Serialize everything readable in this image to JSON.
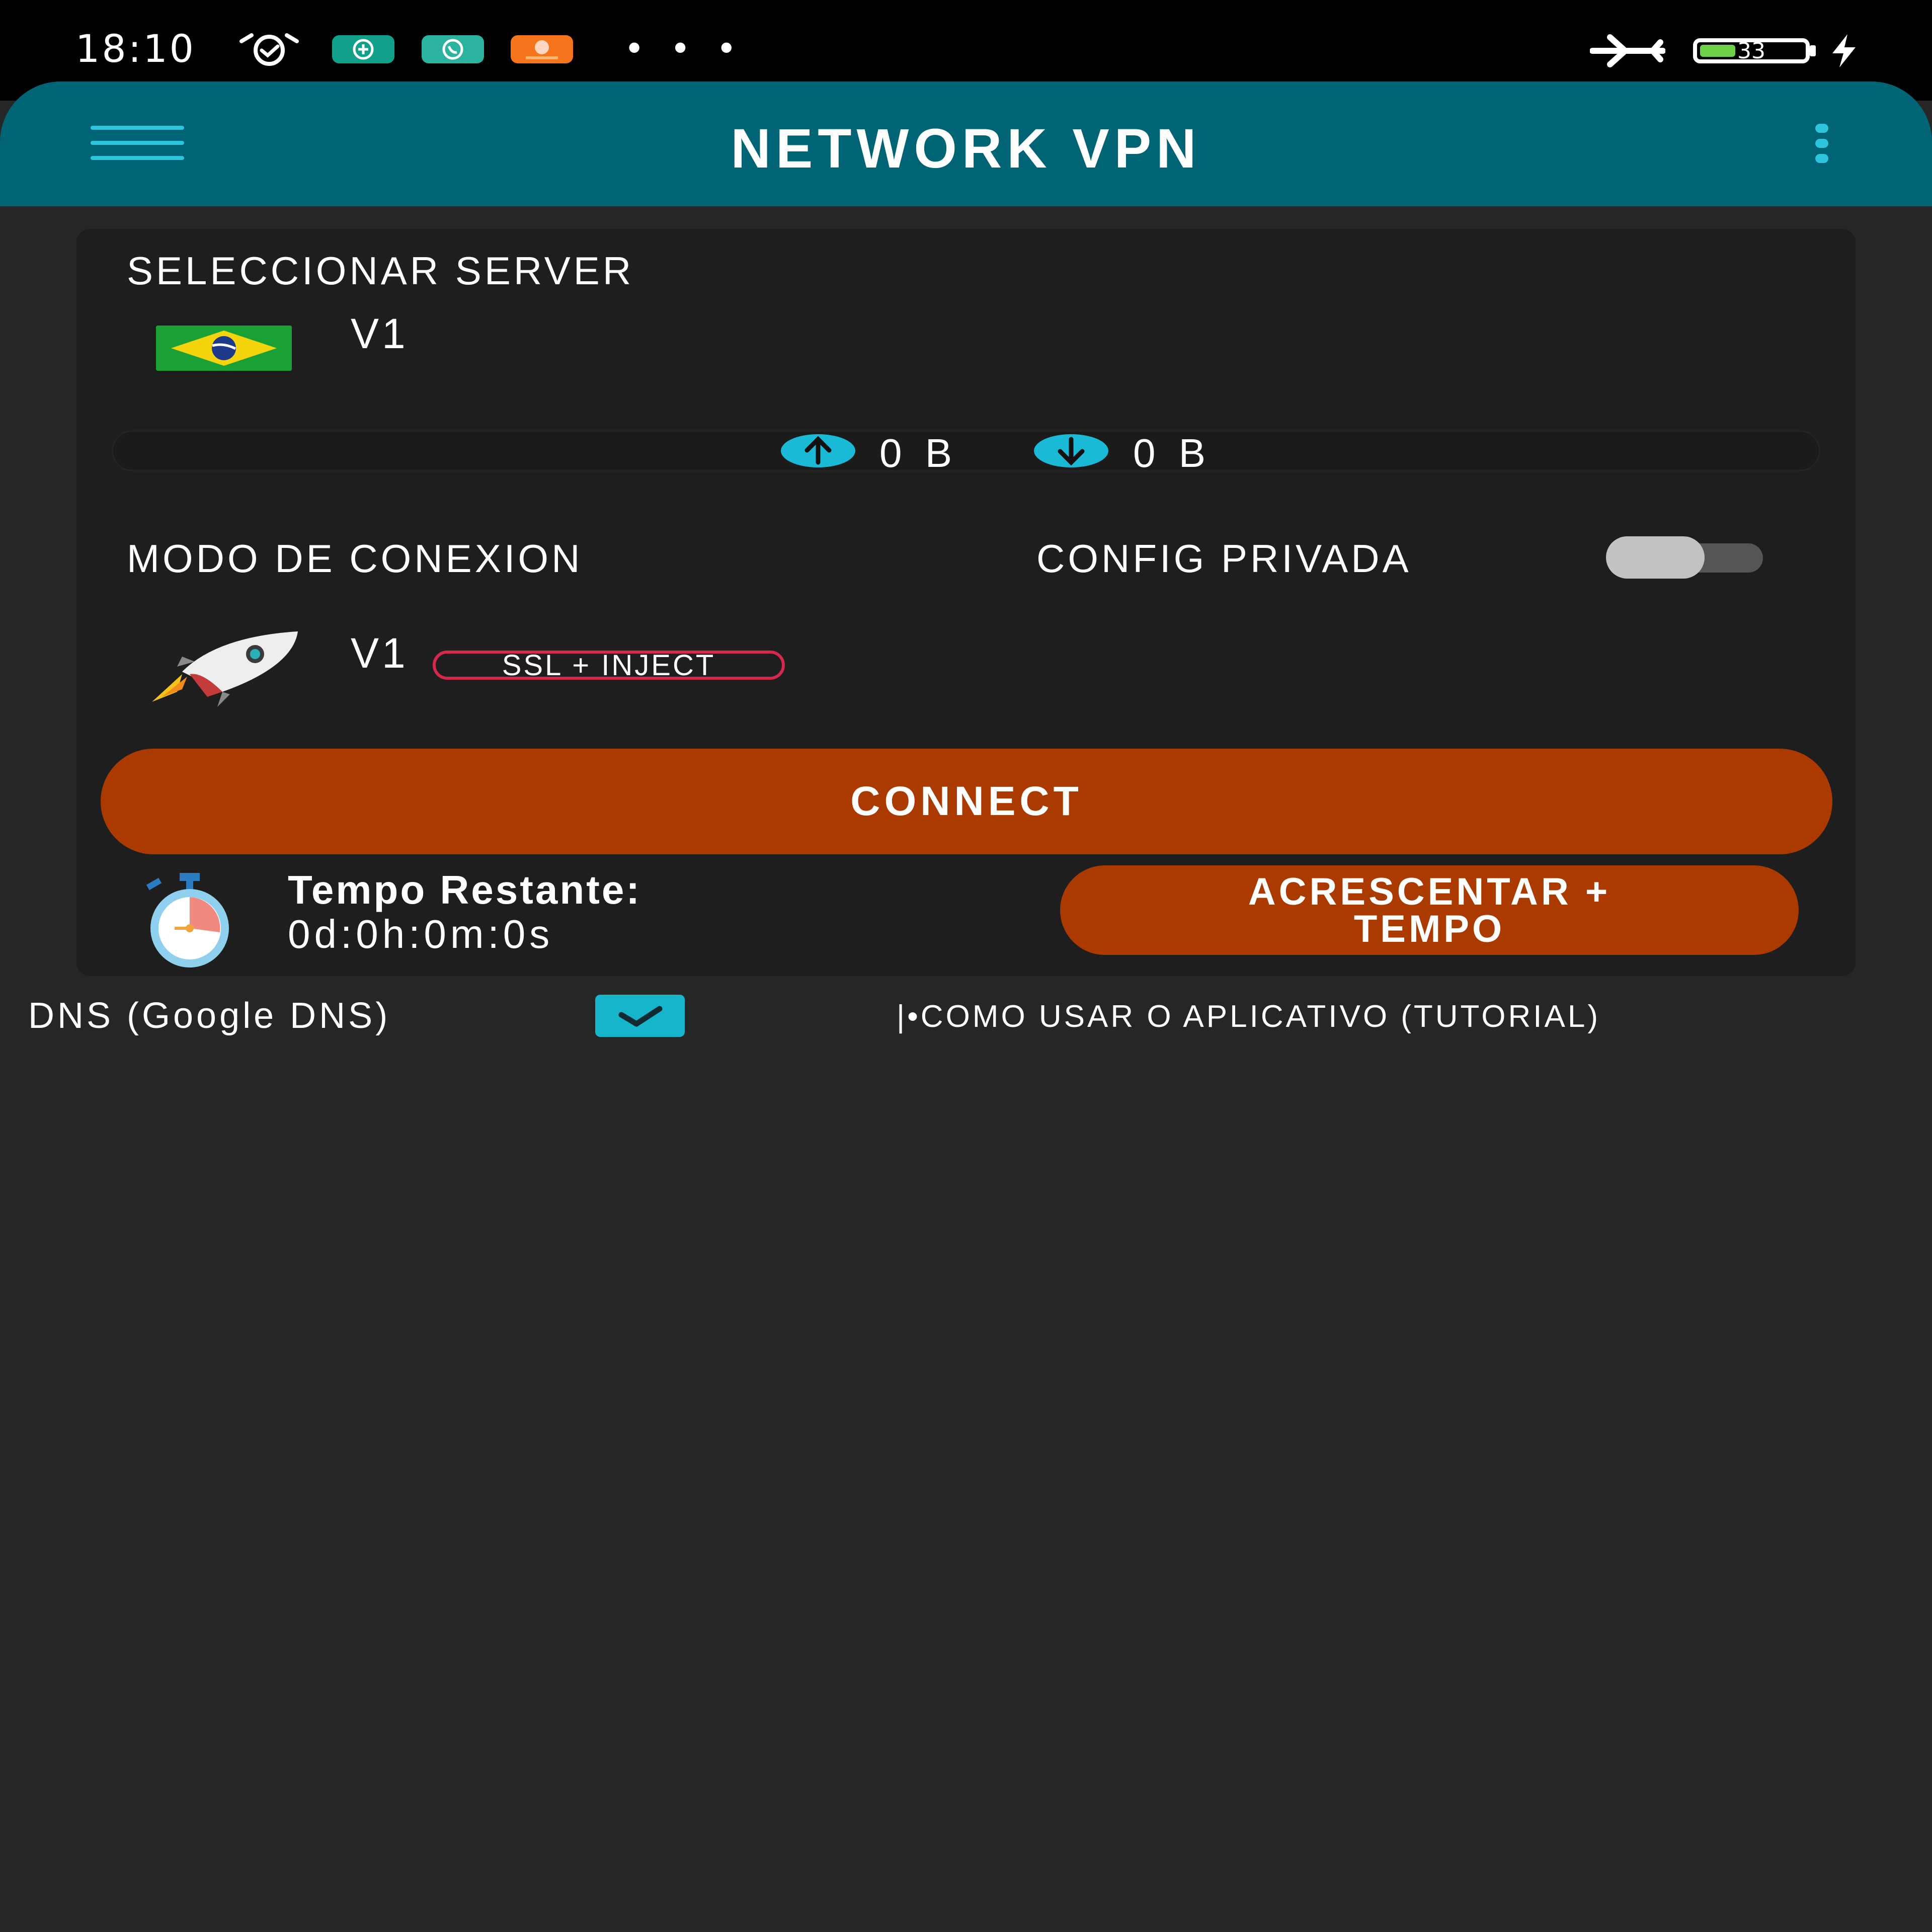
{
  "status_bar": {
    "time": "18:10",
    "battery_level": "33",
    "battery_fraction": 0.33,
    "icons": [
      "alarm-icon",
      "app-plus-icon",
      "whatsapp-icon",
      "app-orange-icon",
      "more-dots-icon",
      "airplane-mode-icon",
      "battery-icon",
      "charging-icon"
    ],
    "dots": "• • •"
  },
  "app_bar": {
    "title": "NETWORK VPN",
    "accent_color": "#006475",
    "icon_color": "#2ec4de"
  },
  "server": {
    "section_label": "SELECCIONAR SERVER",
    "name": "V1",
    "flag": "brazil-flag-icon"
  },
  "traffic": {
    "upload": "0 B",
    "download": "0 B"
  },
  "mode": {
    "section_label": "MODO DE CONEXION",
    "name": "V1",
    "badge": "SSL + INJECT",
    "icon": "rocket-icon"
  },
  "config_private": {
    "label": "CONFIG PRIVADA",
    "enabled": false
  },
  "connect_button": {
    "label": "CONNECT",
    "color": "#aa3a00"
  },
  "timer": {
    "label": "Tempo Restante:",
    "value": "0d:0h:0m:0s",
    "add_time_line1": "ACRESCENTAR +",
    "add_time_line2": "TEMPO"
  },
  "dns": {
    "label": "DNS (Google DNS)",
    "checked": true
  },
  "tutorial": {
    "label": "|•COMO USAR O APLICATIVO (TUTORIAL)"
  }
}
